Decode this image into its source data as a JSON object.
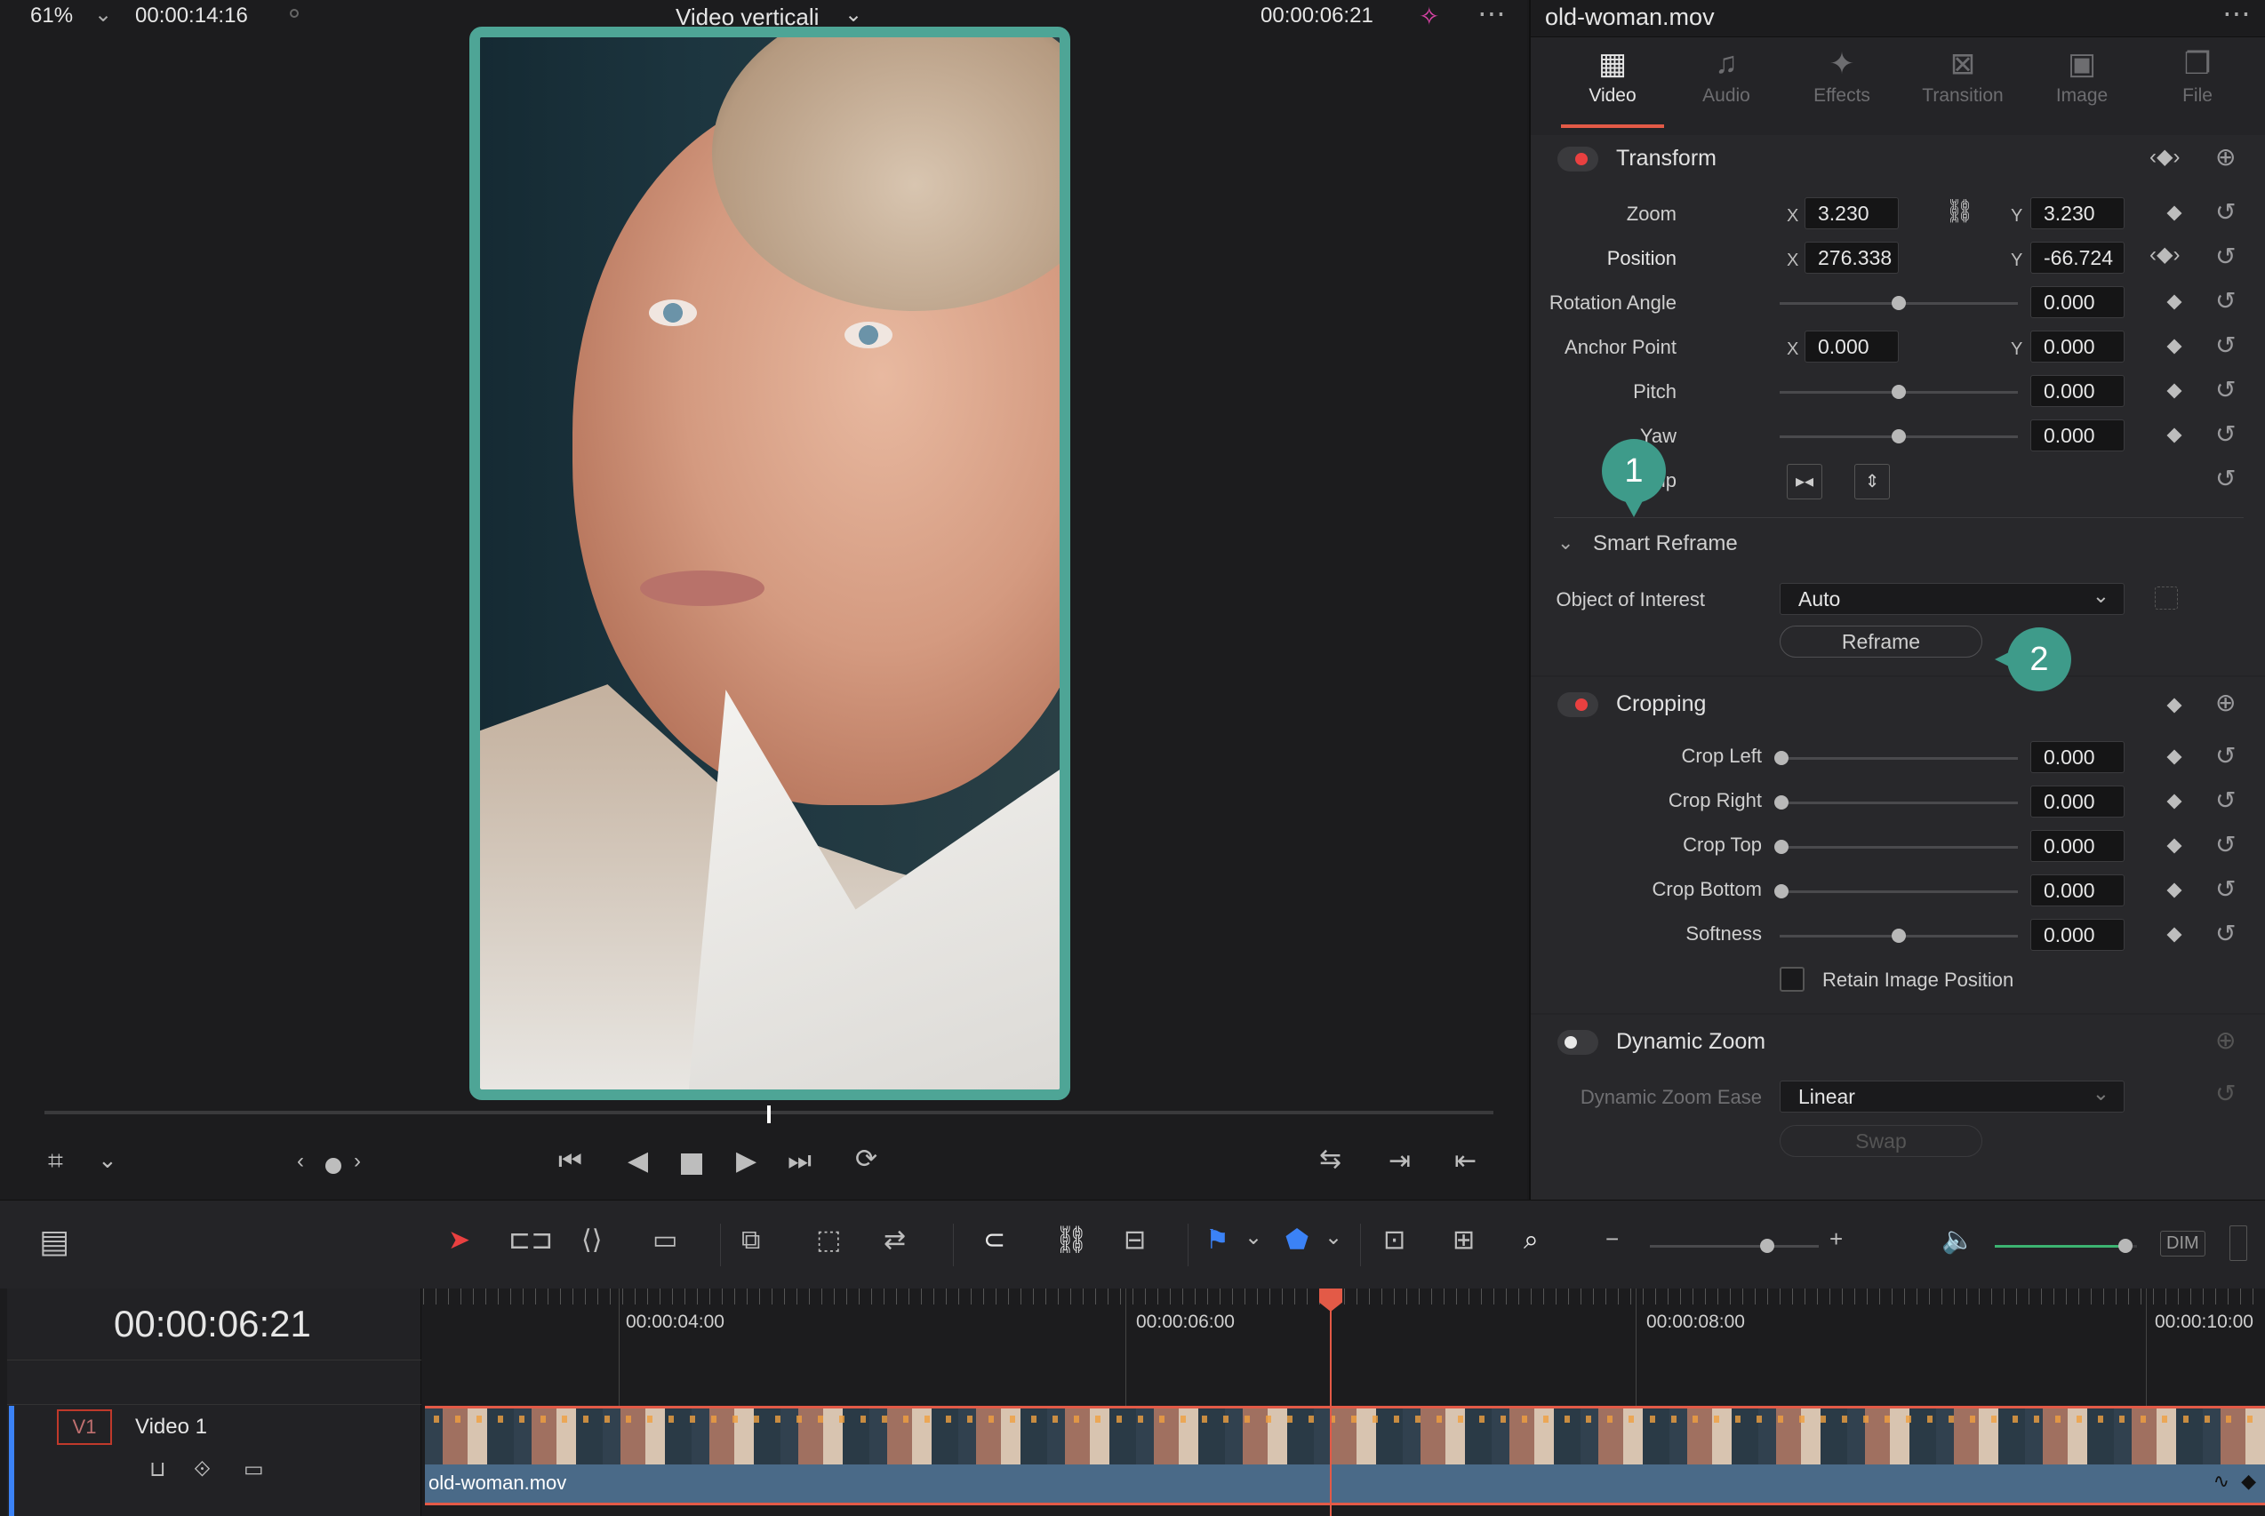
{
  "viewer": {
    "zoom": "61%",
    "source_timecode": "00:00:14:16",
    "timeline_name": "Video verticali",
    "record_timecode": "00:00:06:21",
    "scrub_position": 0.5
  },
  "inspector": {
    "clip_name": "old-woman.mov",
    "tabs": [
      {
        "label": "Video",
        "icon": "film-icon",
        "active": true
      },
      {
        "label": "Audio",
        "icon": "music-note-icon",
        "active": false
      },
      {
        "label": "Effects",
        "icon": "magic-wand-icon",
        "active": false
      },
      {
        "label": "Transition",
        "icon": "transition-icon",
        "active": false
      },
      {
        "label": "Image",
        "icon": "image-icon",
        "active": false
      },
      {
        "label": "File",
        "icon": "file-icon",
        "active": false
      }
    ],
    "transform": {
      "title": "Transform",
      "zoom_label": "Zoom",
      "zoom_x": "3.230",
      "zoom_y": "3.230",
      "position_label": "Position",
      "position_x": "276.338",
      "position_y": "-66.724",
      "rotation_label": "Rotation Angle",
      "rotation": "0.000",
      "anchor_label": "Anchor Point",
      "anchor_x": "0.000",
      "anchor_y": "0.000",
      "pitch_label": "Pitch",
      "pitch": "0.000",
      "yaw_label": "Yaw",
      "yaw": "0.000",
      "flip_label": "Flip",
      "x_axis": "X",
      "y_axis": "Y"
    },
    "smart_reframe": {
      "title": "Smart Reframe",
      "object_label": "Object of Interest",
      "object_value": "Auto",
      "reframe_button": "Reframe"
    },
    "cropping": {
      "title": "Cropping",
      "crop_left_label": "Crop Left",
      "crop_left": "0.000",
      "crop_right_label": "Crop Right",
      "crop_right": "0.000",
      "crop_top_label": "Crop Top",
      "crop_top": "0.000",
      "crop_bottom_label": "Crop Bottom",
      "crop_bottom": "0.000",
      "softness_label": "Softness",
      "softness": "0.000",
      "retain_label": "Retain Image Position"
    },
    "dynamic_zoom": {
      "title": "Dynamic Zoom",
      "ease_label": "Dynamic Zoom Ease",
      "ease_value": "Linear",
      "swap_button": "Swap"
    }
  },
  "callouts": {
    "one": "1",
    "two": "2"
  },
  "timeline": {
    "timecode": "00:00:06:21",
    "ruler_marks": [
      "00:00:04:00",
      "00:00:06:00",
      "00:00:08:00",
      "00:00:10:00"
    ],
    "track_id": "V1",
    "track_name": "Video 1",
    "clip_name": "old-woman.mov",
    "volume_level": 0.92,
    "dim_label": "DIM"
  },
  "colors": {
    "accent_teal": "#4ea596",
    "record_red": "#e94040",
    "playhead_red": "#e35a47"
  }
}
